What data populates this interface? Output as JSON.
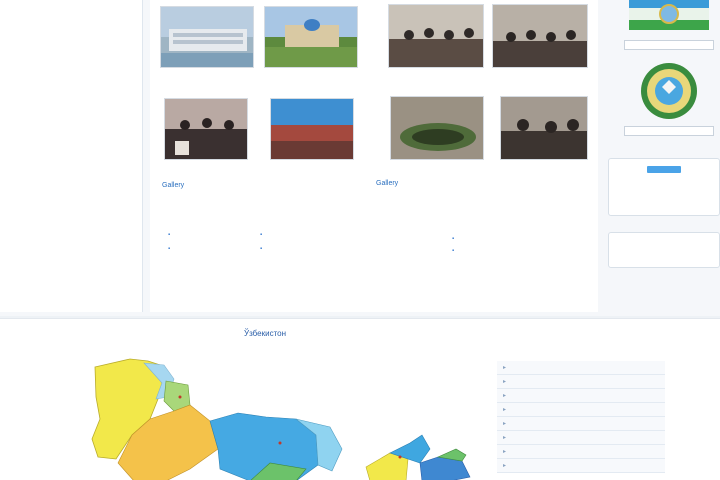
{
  "news": [
    {
      "date": "",
      "title": "",
      "text": "",
      "more": ""
    },
    {
      "date": "",
      "title": "",
      "text": "",
      "more": ""
    },
    {
      "date": "",
      "title": "",
      "text": "",
      "more": ""
    }
  ],
  "gallery": {
    "left_link": "Gallery",
    "right_link": "Gallery"
  },
  "links": [],
  "widgets": [
    {
      "title": "",
      "lines": []
    },
    {
      "title": "",
      "lines": []
    }
  ],
  "map": {
    "title": "Ўзбекистон",
    "regions": []
  },
  "colors": {
    "accent": "#2a5ea8",
    "link": "#2a6fbf",
    "map_yellow": "#f2e84a",
    "map_blue": "#3fa7e0",
    "map_green": "#6cc26a"
  }
}
